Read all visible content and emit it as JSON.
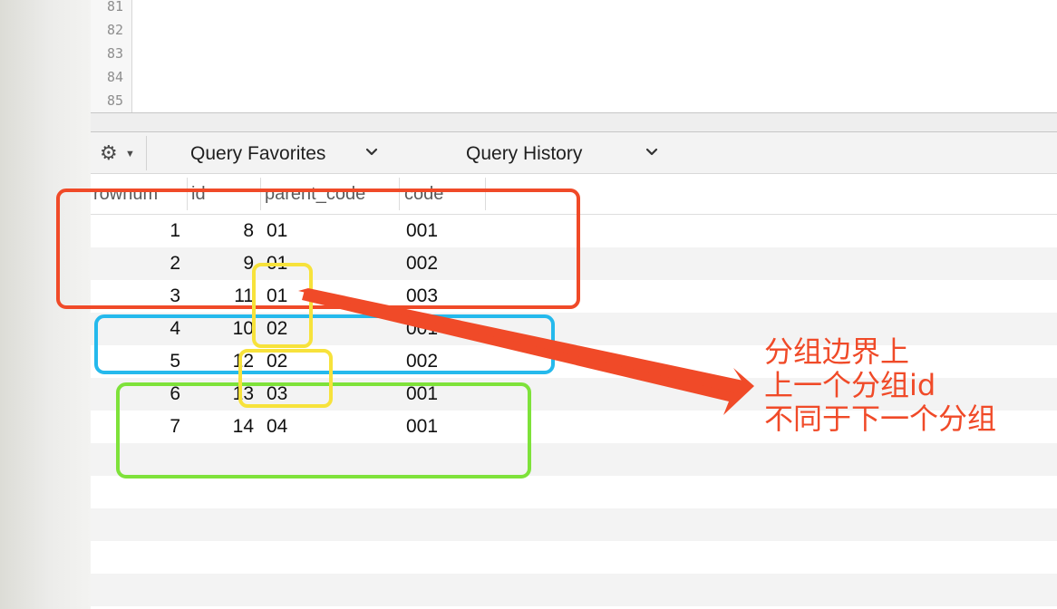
{
  "editor": {
    "line_numbers": [
      "81",
      "82",
      "83",
      "84",
      "85"
    ]
  },
  "toolbar": {
    "gear_icon": "gear-icon",
    "favorites_label": "Query Favorites",
    "history_label": "Query History"
  },
  "grid": {
    "columns": [
      "rownum",
      "id",
      "parent_code",
      "code"
    ],
    "rows": [
      [
        "1",
        "8",
        "01",
        "001"
      ],
      [
        "2",
        "9",
        "01",
        "002"
      ],
      [
        "3",
        "11",
        "01",
        "003"
      ],
      [
        "4",
        "10",
        "02",
        "001"
      ],
      [
        "5",
        "12",
        "02",
        "002"
      ],
      [
        "6",
        "13",
        "03",
        "001"
      ],
      [
        "7",
        "14",
        "04",
        "001"
      ]
    ]
  },
  "annotation": {
    "lines": [
      "分组边界上",
      "上一个分组id",
      "不同于下一个分组"
    ]
  },
  "colors": {
    "highlight_red": "#f04a28",
    "highlight_blue": "#25b9ec",
    "highlight_green": "#7ee23a",
    "highlight_yellow": "#f7e23b",
    "arrow": "#f04a28"
  }
}
